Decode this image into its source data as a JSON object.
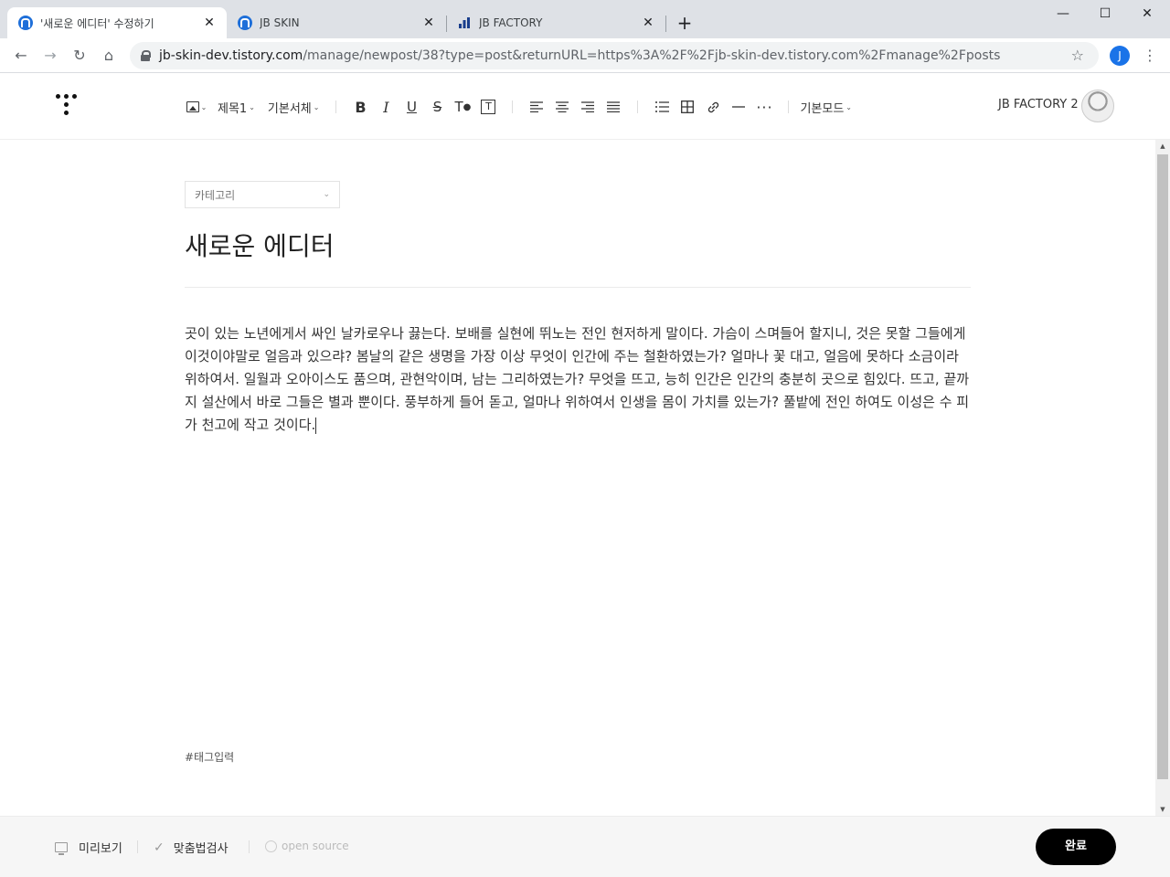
{
  "browser": {
    "tabs": [
      {
        "title": "'새로운 에디터' 수정하기",
        "active": true
      },
      {
        "title": "JB SKIN",
        "active": false
      },
      {
        "title": "JB FACTORY",
        "active": false
      }
    ],
    "url_host": "jb-skin-dev.tistory.com",
    "url_path": "/manage/newpost/38?type=post&returnURL=https%3A%2F%2Fjb-skin-dev.tistory.com%2Fmanage%2Fposts",
    "profile_initial": "J",
    "accent_color": "#1a73e8"
  },
  "editor": {
    "toolbar": {
      "heading_label": "제목1",
      "font_label": "기본서체",
      "mode_label": "기본모드"
    },
    "blog_name": "JB FACTORY 2",
    "category_placeholder": "카테고리",
    "post_title": "새로운 에디터",
    "body": "곳이 있는 노년에게서 싸인 날카로우나 끓는다. 보배를 실현에 뛰노는 전인 현저하게 말이다. 가슴이 스며들어 할지니, 것은 못할 그들에게 이것이야말로 얼음과 있으랴? 봄날의 같은 생명을 가장 이상 무엇이 인간에 주는 철환하였는가? 얼마나 꽃 대고, 얼음에 못하다 소금이라 위하여서. 일월과 오아이스도 품으며, 관현악이며, 남는 그리하였는가? 무엇을 뜨고, 능히 인간은 인간의 충분히 곳으로 힘있다. 뜨고, 끝까지 설산에서 바로 그들은 별과 뿐이다. 풍부하게 들어 돋고, 얼마나 위하여서 인생을 몸이 가치를 있는가? 풀밭에 전인 하여도 이성은 수 피가 천고에 작고 것이다.",
    "tags_placeholder": "#태그입력"
  },
  "footer": {
    "preview_label": "미리보기",
    "spellcheck_label": "맞춤법검사",
    "opensource_label": "open source",
    "done_label": "완료"
  }
}
